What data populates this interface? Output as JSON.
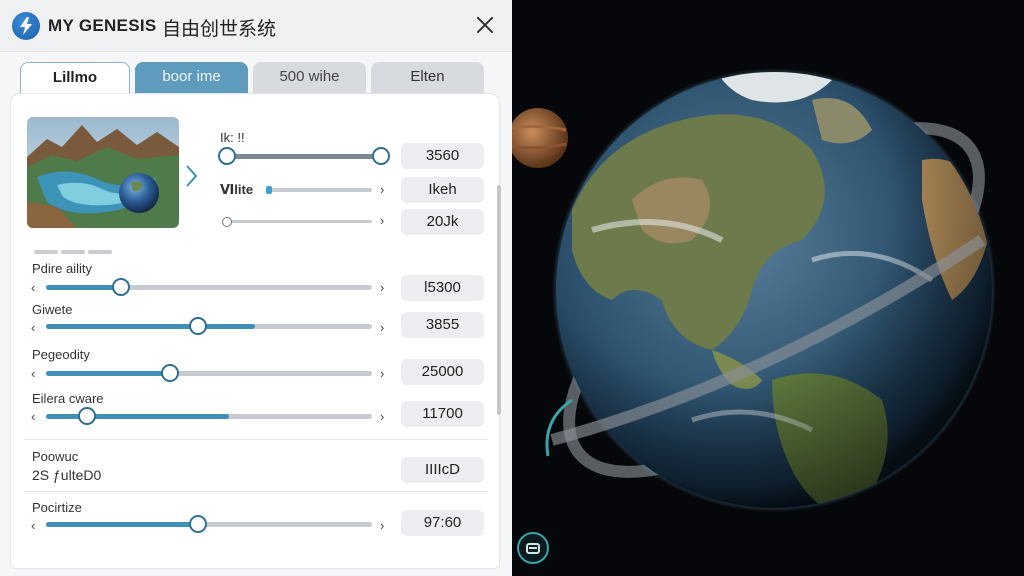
{
  "header": {
    "title": "MY GENESIS",
    "subtitle": "自由创世系统"
  },
  "tabs": [
    {
      "label": "Lillmo",
      "active": true
    },
    {
      "label": "boor ime",
      "active": false
    },
    {
      "label": "500 wihe",
      "active": false
    },
    {
      "label": "Elten",
      "active": false
    }
  ],
  "preset": {
    "rows": [
      {
        "label": "Ik: !!",
        "value": "3560",
        "fill": 0.98,
        "knob": 0.0
      },
      {
        "label": "Ⅵlite",
        "value": "Ikeh",
        "fill": 0.06
      },
      {
        "label": "",
        "value": "20Jk",
        "fill": 0.0
      }
    ]
  },
  "sliders": [
    {
      "label": "Pdire aility",
      "value": "l5300",
      "fill": 0.23
    },
    {
      "label": "Giwete",
      "value": "3855",
      "fill": 0.64
    },
    {
      "label": "Pegeodity",
      "value": "25000",
      "fill": 0.38
    },
    {
      "label": "Eilera cware",
      "value": "11700",
      "fill": 0.56
    }
  ],
  "info": {
    "label": "Poowuc",
    "value_text": "2S ƒulteD0",
    "box": "IIIIcD"
  },
  "last_slider": {
    "label": "Pocirtize",
    "value": "97:60",
    "fill": 0.47
  },
  "colors": {
    "accent": "#3f8fb6",
    "tab_active_blue": "#5e9bbd",
    "knob_border": "#2f6f93",
    "reset_ring": "#3aa3a8"
  },
  "icons": {
    "logo": "lightning-icon",
    "close": "close-icon",
    "next": "chevron-right-icon",
    "reset": "reset-view-icon"
  }
}
